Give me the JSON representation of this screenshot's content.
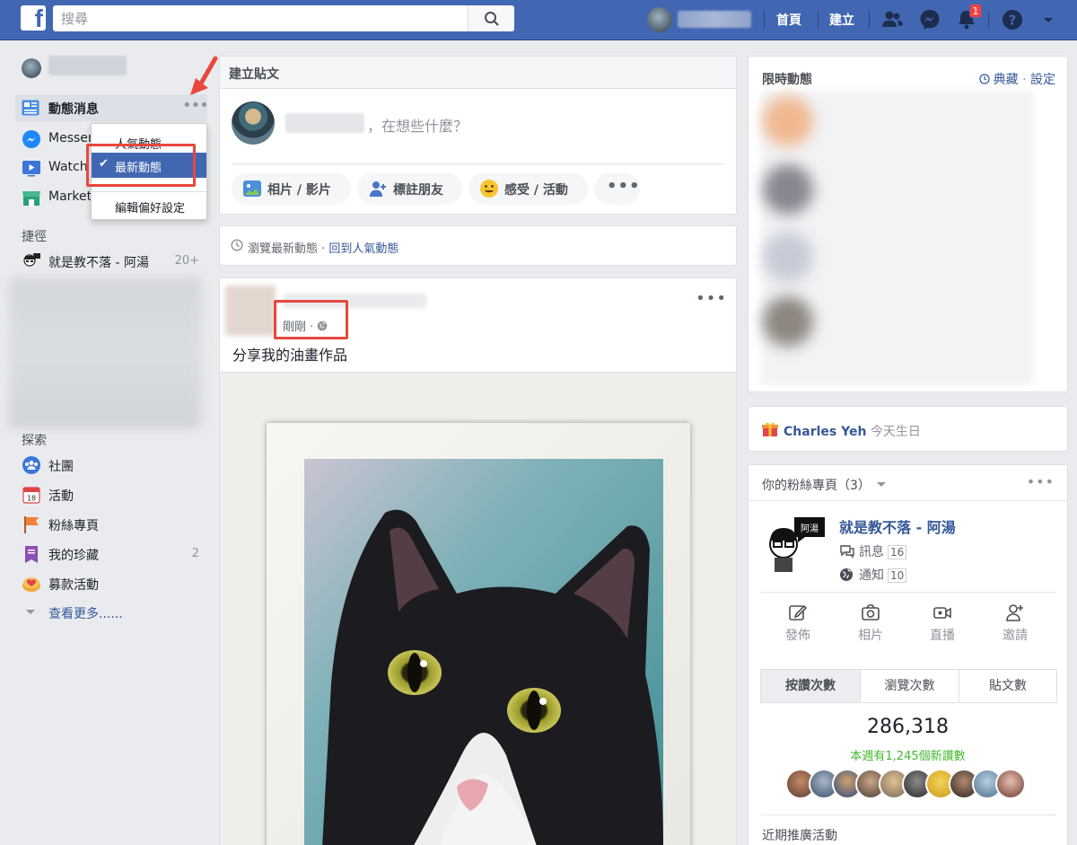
{
  "topbar": {
    "logo": "f",
    "search_placeholder": "搜尋",
    "home": "首頁",
    "create": "建立",
    "notification_count": "1"
  },
  "sidebar": {
    "news_feed": "動態消息",
    "items": [
      {
        "label": "Messenger",
        "icon": "messenger-icon"
      },
      {
        "label": "Watch",
        "icon": "watch-icon"
      },
      {
        "label": "Marketplace",
        "icon": "marketplace-icon"
      }
    ],
    "shortcuts_heading": "捷徑",
    "shortcut": {
      "label": "就是教不落 - 阿湯",
      "count": "20+"
    },
    "explore_heading": "探索",
    "explore": [
      {
        "label": "社團",
        "count": ""
      },
      {
        "label": "活動",
        "count": ""
      },
      {
        "label": "粉絲專頁",
        "count": ""
      },
      {
        "label": "我的珍藏",
        "count": "2"
      },
      {
        "label": "募款活動",
        "count": ""
      }
    ],
    "see_more": "查看更多......"
  },
  "dropdown": {
    "items": [
      "人氣動態",
      "最新動態",
      "編輯偏好設定"
    ],
    "selected_check": "✔"
  },
  "composer": {
    "header": "建立貼文",
    "prompt": "，在想些什麼？",
    "actions": [
      "相片 / 影片",
      "標註朋友",
      "感受 / 活動"
    ],
    "more": "•••"
  },
  "feed_bar": {
    "text": "瀏覽最新動態 · ",
    "link": "回到人氣動態"
  },
  "post": {
    "time": "剛剛 · ",
    "text": "分享我的油畫作品",
    "more": "•••"
  },
  "stories": {
    "title": "限時動態",
    "archive": "典藏",
    "separator": " · ",
    "settings": "設定"
  },
  "birthday": {
    "name": "Charles Yeh",
    "text": " 今天生日"
  },
  "pages_widget": {
    "title": "你的粉絲專頁（3）",
    "more": "•••",
    "page_name": "就是教不落 - 阿湯",
    "avatar_tag": "阿湯",
    "messages_label": "訊息",
    "messages_count": "16",
    "notifications_label": "通知",
    "notifications_count": "10",
    "actions": [
      "發佈",
      "相片",
      "直播",
      "邀請"
    ],
    "tabs": [
      "按讚次數",
      "瀏覽次數",
      "貼文數"
    ],
    "likes_total": "286,318",
    "new_likes": "本週有1,245個新讚數",
    "recent_promotions": "近期推廣活動"
  }
}
